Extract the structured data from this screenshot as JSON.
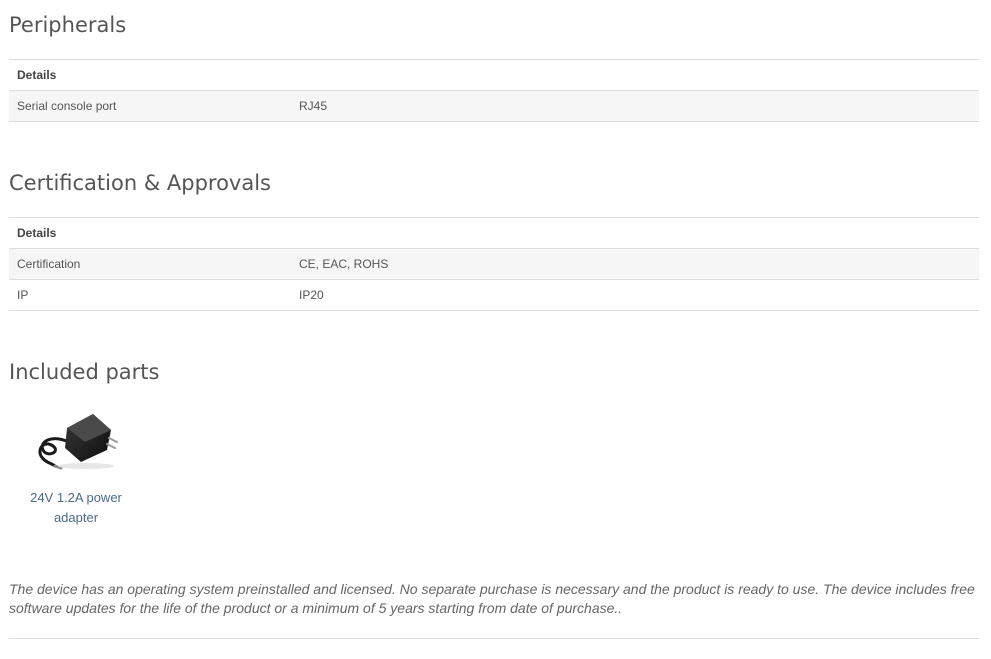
{
  "peripherals": {
    "title": "Peripherals",
    "header": "Details",
    "rows": [
      {
        "label": "Serial console port",
        "value": "RJ45"
      }
    ]
  },
  "certification": {
    "title": "Certification & Approvals",
    "header": "Details",
    "rows": [
      {
        "label": "Certification",
        "value": "CE, EAC, ROHS"
      },
      {
        "label": "IP",
        "value": "IP20"
      }
    ]
  },
  "included_parts": {
    "title": "Included parts",
    "items": [
      {
        "label": "24V 1.2A power adapter",
        "icon": "power-adapter-image"
      }
    ]
  },
  "note": "The device has an operating system preinstalled and licensed. No separate purchase is necessary and the product is ready to use. The device includes free software updates for the life of the product or a minimum of 5 years starting from date of purchase.."
}
